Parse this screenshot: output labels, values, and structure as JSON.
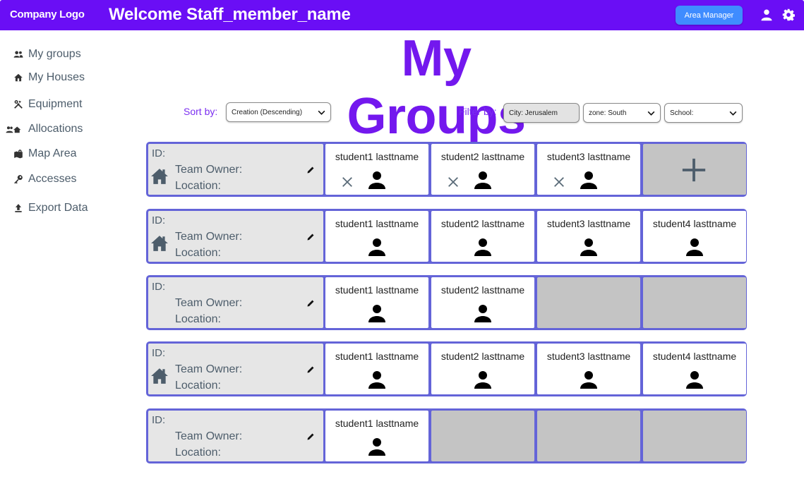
{
  "header": {
    "logo": "Company Logo",
    "welcome": "Welcome Staff_member_name",
    "role_button": "Area Manager",
    "user_icon": "user-icon",
    "settings_icon": "gear-icon"
  },
  "sidebar": {
    "items": [
      {
        "label": "My groups",
        "icon": "group-icon"
      },
      {
        "label": "My Houses",
        "icon": "home-icon"
      },
      {
        "label": "Equipment",
        "icon": "tools-icon"
      },
      {
        "label": "Allocations",
        "icon": "allocation-icon"
      },
      {
        "label": "Map Area",
        "icon": "map-icon"
      },
      {
        "label": "Accesses",
        "icon": "key-icon"
      },
      {
        "label": "Export Data",
        "icon": "upload-icon"
      }
    ]
  },
  "page": {
    "title": "My Groups"
  },
  "controls": {
    "sort_label": "Sort by:",
    "sort_value": "Creation (Descending)",
    "filter_label": "Filter by:",
    "filter_city": "City: Jerusalem",
    "filter_zone": "zone: South",
    "filter_school": "School:"
  },
  "groups": [
    {
      "id_label": "ID:",
      "owner_label": "Team Owner:",
      "location_label": "Location:",
      "has_house": true,
      "students": [
        "student1 lasttname",
        "student2 lasttname",
        "student3 lasttname"
      ]
    },
    {
      "id_label": "ID:",
      "owner_label": "Team Owner:",
      "location_label": "Location:",
      "has_house": true,
      "students": [
        "student1 lasttname",
        "student2 lasttname",
        "student3 lasttname",
        "student4 lasttname"
      ]
    },
    {
      "id_label": "ID:",
      "owner_label": "Team Owner:",
      "location_label": "Location:",
      "has_house": false,
      "students": [
        "student1 lasttname",
        "student2 lasttname"
      ]
    },
    {
      "id_label": "ID:",
      "owner_label": "Team Owner:",
      "location_label": "Location:",
      "has_house": true,
      "students": [
        "student1 lasttname",
        "student2 lasttname",
        "student3 lasttname",
        "student4 lasttname"
      ]
    },
    {
      "id_label": "ID:",
      "owner_label": "Team Owner:",
      "location_label": "Location:",
      "has_house": false,
      "students": [
        "student1 lasttname"
      ]
    }
  ],
  "colors": {
    "header": "#6a0ef5",
    "title": "#7318ee",
    "role_button": "#3f8cff",
    "row_border": "#6464d8",
    "empty_slot": "#c4c4c4"
  }
}
